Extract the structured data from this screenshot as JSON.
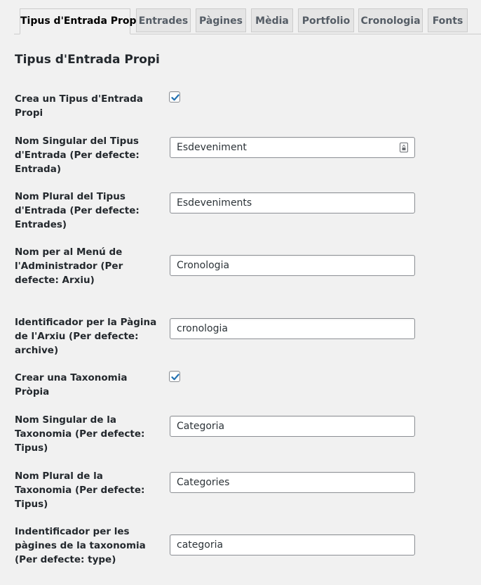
{
  "tabs": [
    {
      "label": "Tipus d'Entrada Propi",
      "active": true
    },
    {
      "label": "Entrades",
      "active": false
    },
    {
      "label": "Pàgines",
      "active": false
    },
    {
      "label": "Mèdia",
      "active": false
    },
    {
      "label": "Portfolio",
      "active": false
    },
    {
      "label": "Cronologia",
      "active": false
    },
    {
      "label": "Fonts",
      "active": false
    }
  ],
  "section_title": "Tipus d'Entrada Propi",
  "fields": {
    "create_post_type": {
      "label": "Crea un Tipus d'Entrada Propi",
      "checked": true
    },
    "singular_name": {
      "label": "Nom Singular del Tipus d'Entrada (Per defecte: Entrada)",
      "value": "Esdeveniment",
      "icon": "password-manager-icon"
    },
    "plural_name": {
      "label": "Nom Plural del Tipus d'Entrada (Per defecte: Entrades)",
      "value": "Esdeveniments"
    },
    "admin_menu_name": {
      "label": "Nom per al Menú de l'Administrador (Per defecte: Arxiu)",
      "value": "Cronologia"
    },
    "archive_slug": {
      "label": "Identificador per la Pàgina de l'Arxiu (Per defecte: archive)",
      "value": "cronologia"
    },
    "create_taxonomy": {
      "label": "Crear una Taxonomia Pròpia",
      "checked": true
    },
    "taxonomy_singular": {
      "label": "Nom Singular de la Taxonomia (Per defecte: Tipus)",
      "value": "Categoria"
    },
    "taxonomy_plural": {
      "label": "Nom Plural de la Taxonomia (Per defecte: Tipus)",
      "value": "Categories"
    },
    "taxonomy_slug": {
      "label": "Indentificador per les pàgines de la taxonomia (Per defecte: type)",
      "value": "categoria"
    }
  },
  "colors": {
    "checkmark": "#2271b1",
    "background": "#f1f1f1"
  }
}
